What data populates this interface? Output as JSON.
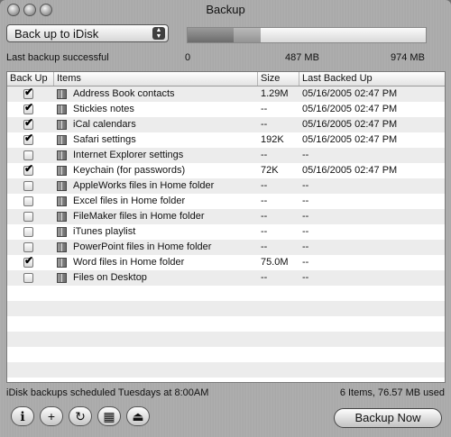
{
  "window": {
    "title": "Backup"
  },
  "toolbar": {
    "destination": "Back up to iDisk",
    "status": "Last backup successful",
    "capacity_used_fraction": 0.195,
    "capacity_selected_fraction": 0.305,
    "scale": {
      "min": "0",
      "mid": "487 MB",
      "max": "974 MB"
    }
  },
  "table": {
    "headers": {
      "backup": "Back Up",
      "items": "Items",
      "size": "Size",
      "last": "Last Backed Up"
    },
    "rows": [
      {
        "checked": true,
        "name": "Address Book contacts",
        "size": "1.29M",
        "last": "05/16/2005 02:47 PM"
      },
      {
        "checked": true,
        "name": "Stickies notes",
        "size": "--",
        "last": "05/16/2005 02:47 PM"
      },
      {
        "checked": true,
        "name": "iCal calendars",
        "size": "--",
        "last": "05/16/2005 02:47 PM"
      },
      {
        "checked": true,
        "name": "Safari settings",
        "size": "192K",
        "last": "05/16/2005 02:47 PM"
      },
      {
        "checked": false,
        "name": "Internet Explorer settings",
        "size": "--",
        "last": "--"
      },
      {
        "checked": true,
        "name": "Keychain (for passwords)",
        "size": "72K",
        "last": "05/16/2005 02:47 PM"
      },
      {
        "checked": false,
        "name": "AppleWorks files in Home folder",
        "size": "--",
        "last": "--"
      },
      {
        "checked": false,
        "name": "Excel files in Home folder",
        "size": "--",
        "last": "--"
      },
      {
        "checked": false,
        "name": "FileMaker files in Home folder",
        "size": "--",
        "last": "--"
      },
      {
        "checked": false,
        "name": "iTunes playlist",
        "size": "--",
        "last": "--"
      },
      {
        "checked": false,
        "name": "PowerPoint files in Home folder",
        "size": "--",
        "last": "--"
      },
      {
        "checked": true,
        "name": "Word files in Home folder",
        "size": "75.0M",
        "last": "--"
      },
      {
        "checked": false,
        "name": "Files on Desktop",
        "size": "--",
        "last": "--"
      }
    ],
    "empty_rows": 6
  },
  "footer": {
    "schedule": "iDisk backups scheduled Tuesdays at 8:00AM",
    "summary": "6 Items, 76.57 MB used",
    "buttons": [
      {
        "name": "info-icon",
        "glyph": "ℹ"
      },
      {
        "name": "add-icon",
        "glyph": "+"
      },
      {
        "name": "refresh-icon",
        "glyph": "↻"
      },
      {
        "name": "calendar-icon",
        "glyph": "▦"
      },
      {
        "name": "eject-icon",
        "glyph": "⏏"
      }
    ],
    "backup_now": "Backup Now"
  }
}
